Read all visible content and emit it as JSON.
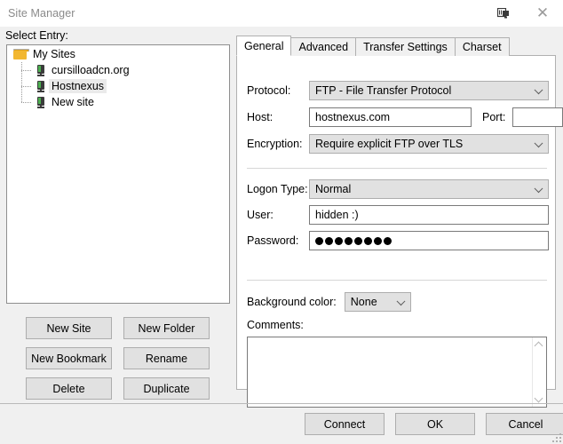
{
  "window": {
    "title": "Site Manager",
    "icons": [
      {
        "name": "display-icon",
        "glyph": "▤"
      },
      {
        "name": "close-icon",
        "glyph": "✕"
      }
    ]
  },
  "left_pane": {
    "select_entry_label": "Select Entry:",
    "tree": {
      "root_label": "My Sites",
      "children": [
        {
          "label": "cursilloadcn.org",
          "selected": false
        },
        {
          "label": "Hostnexus",
          "selected": true
        },
        {
          "label": "New site",
          "selected": false
        }
      ]
    },
    "buttons": [
      "New Site",
      "New Folder",
      "New Bookmark",
      "Rename",
      "Delete",
      "Duplicate"
    ]
  },
  "right_panel": {
    "tabs": [
      {
        "label": "General",
        "active": true
      },
      {
        "label": "Advanced",
        "active": false
      },
      {
        "label": "Transfer Settings",
        "active": false
      },
      {
        "label": "Charset",
        "active": false
      }
    ],
    "general": {
      "protocol_label": "Protocol:",
      "protocol_value": "FTP - File Transfer Protocol",
      "host_label": "Host:",
      "host_value": "hostnexus.com",
      "port_label": "Port:",
      "port_value": "",
      "encryption_label": "Encryption:",
      "encryption_value": "Require explicit FTP over TLS",
      "logon_type_label": "Logon Type:",
      "logon_type_value": "Normal",
      "user_label": "User:",
      "user_value": "hidden :)",
      "password_label": "Password:",
      "password_dots": 8,
      "background_color_label": "Background color:",
      "background_color_value": "None",
      "comments_label": "Comments:",
      "comments_value": ""
    }
  },
  "footer": {
    "buttons": [
      "Connect",
      "OK",
      "Cancel"
    ]
  },
  "colors": {
    "dialog_bg": "#f0f0f0",
    "panel_bg": "#ffffff",
    "button_bg": "#e1e1e1",
    "button_border": "#adadad",
    "field_border": "#7a7a7a",
    "title_text": "#8a8a8a",
    "folder_icon": "#f2b731",
    "server_led": "#4caf50"
  }
}
